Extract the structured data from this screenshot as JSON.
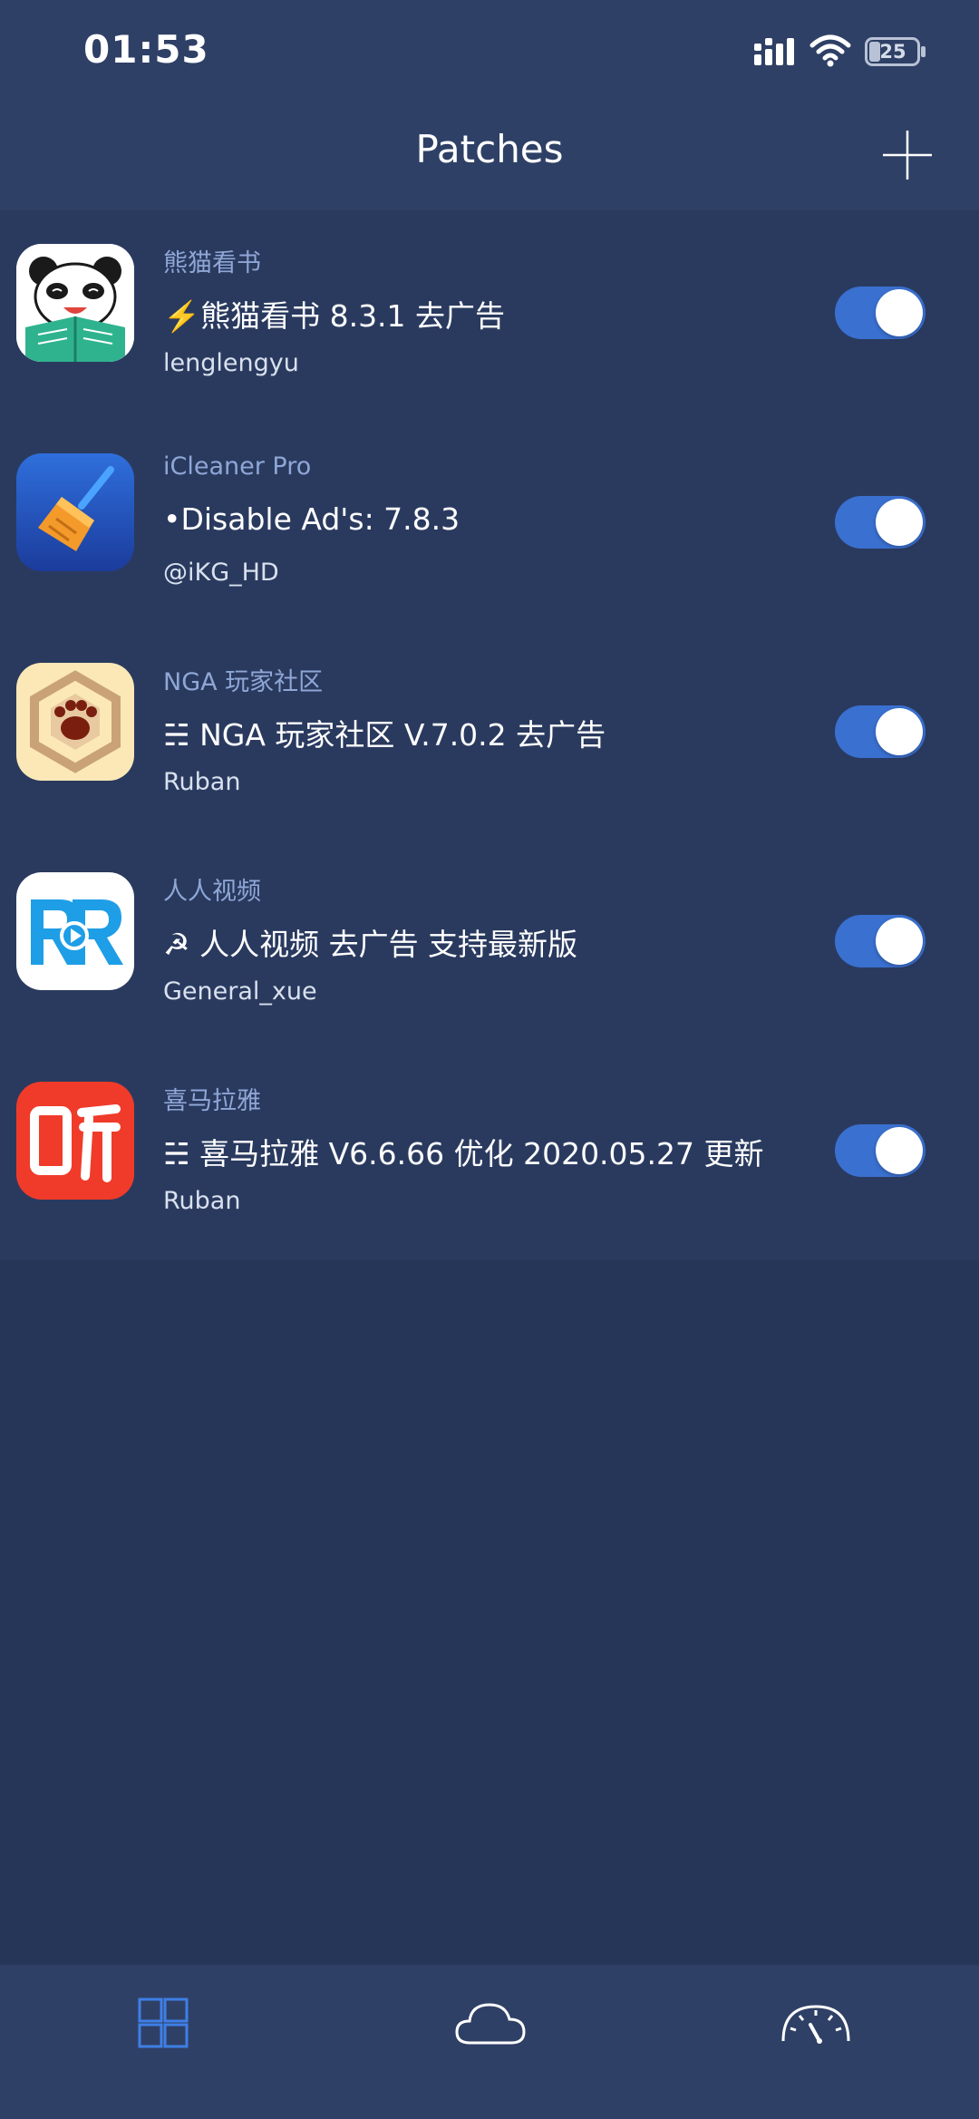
{
  "status_bar": {
    "time": "01:53",
    "battery_level": "25"
  },
  "header": {
    "title": "Patches",
    "add_icon": "plus-icon"
  },
  "patches": [
    {
      "app_name": "熊猫看书",
      "title": "⚡️熊猫看书 8.3.1 去广告",
      "author": "lenglengyu",
      "enabled": true,
      "icon": "panda-reading-icon"
    },
    {
      "app_name": "iCleaner Pro",
      "title": "•Disable Ad's: 7.8.3",
      "author": "@iKG_HD",
      "enabled": true,
      "icon": "broom-icon"
    },
    {
      "app_name": "NGA 玩家社区",
      "title": "☵ NGA 玩家社区 V.7.0.2 去广告",
      "author": "Ruban",
      "enabled": true,
      "icon": "bear-paw-icon"
    },
    {
      "app_name": "人人视频",
      "title": "☭ 人人视频 去广告 支持最新版",
      "author": "General_xue",
      "enabled": true,
      "icon": "rr-play-icon"
    },
    {
      "app_name": "喜马拉雅",
      "title": "☵ 喜马拉雅 V6.6.66 优化 2020.05.27 更新",
      "author": "Ruban",
      "enabled": true,
      "icon": "ting-icon"
    }
  ],
  "tab_bar": {
    "tabs": [
      "grid-icon",
      "cloud-icon",
      "speedometer-icon"
    ],
    "active_tab": "grid-icon"
  },
  "colors": {
    "background": "#263658",
    "list_background": "#2a3a5f",
    "toggle_on": "#3a70d0",
    "app_name_color": "#8fa7d6",
    "active_tab": "#3f7fe6"
  }
}
